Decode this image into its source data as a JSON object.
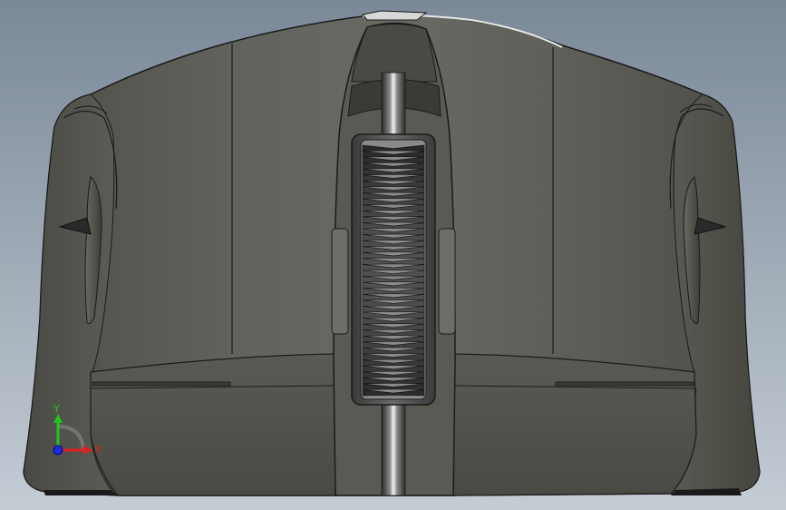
{
  "viewport": {
    "background_top": "#7a8898",
    "background_bottom": "#c4ccd4"
  },
  "model": {
    "body_color": "#5e5e58",
    "edge_color": "#1a1a1a",
    "wheel_color": "#3c3c3c",
    "chrome_light": "#f4f4f4"
  },
  "triad": {
    "y_label": "Y",
    "x_label": "X",
    "y_color": "#22c422",
    "x_color": "#e02020",
    "z_color": "#1a2adc"
  }
}
